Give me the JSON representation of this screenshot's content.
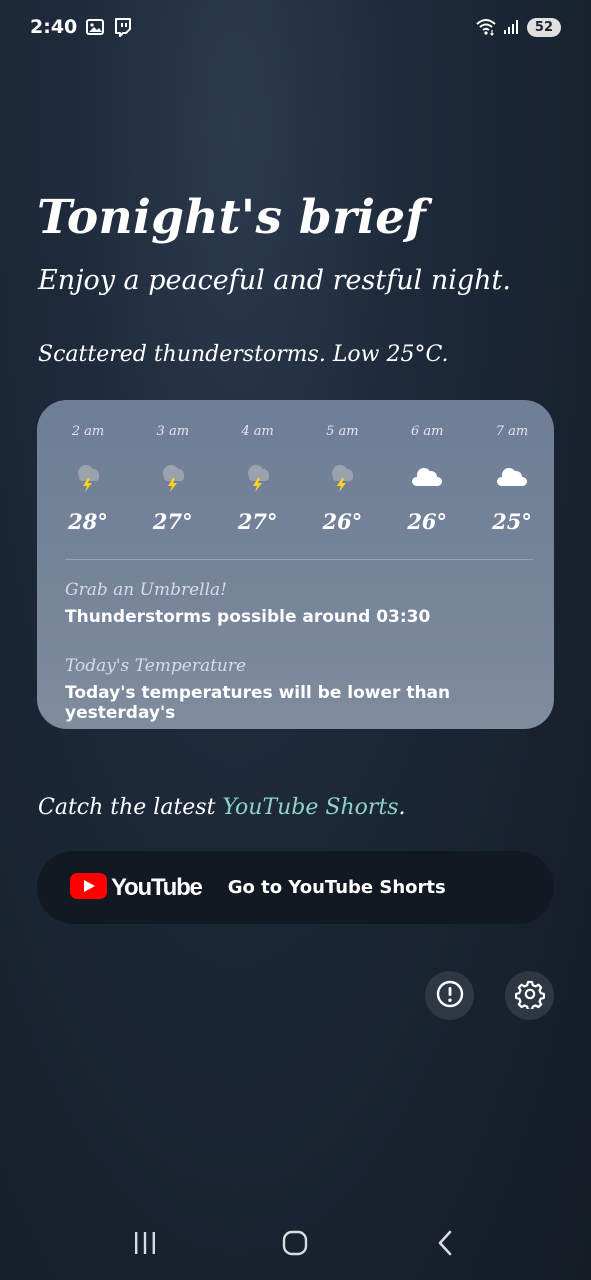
{
  "status_bar": {
    "time": "2:40",
    "notification_icons": [
      "image-icon",
      "twitch-icon"
    ],
    "system_icons": [
      "wifi-icon",
      "signal-icon"
    ],
    "battery": "52"
  },
  "brief": {
    "title": "Tonight's brief",
    "subtitle": "Enjoy a peaceful and restful night.",
    "summary": "Scattered thunderstorms. Low 25°C."
  },
  "forecast": {
    "hours": [
      {
        "time": "2 am",
        "icon": "thunderstorm-icon",
        "temp": "28°"
      },
      {
        "time": "3 am",
        "icon": "thunderstorm-icon",
        "temp": "27°"
      },
      {
        "time": "4 am",
        "icon": "thunderstorm-icon",
        "temp": "27°"
      },
      {
        "time": "5 am",
        "icon": "thunderstorm-icon",
        "temp": "26°"
      },
      {
        "time": "6 am",
        "icon": "cloud-icon",
        "temp": "26°"
      },
      {
        "time": "7 am",
        "icon": "cloud-icon",
        "temp": "25°"
      }
    ],
    "alerts": [
      {
        "heading": "Grab an Umbrella!",
        "body": "Thunderstorms possible around 03:30"
      },
      {
        "heading": "Today's Temperature",
        "body": "Today's temperatures will be lower than yesterday's"
      }
    ]
  },
  "youtube": {
    "caption_prefix": "Catch the latest ",
    "caption_link": "YouTube Shorts",
    "caption_suffix": ".",
    "logo_text": "YouTube",
    "button_label": "Go to YouTube Shorts"
  },
  "actions": {
    "info_icon": "info-icon",
    "settings_icon": "gear-icon"
  },
  "nav": {
    "icons": [
      "recents-icon",
      "home-icon",
      "back-icon"
    ]
  },
  "colors": {
    "background": "#1e2a3b",
    "card": "#76849a",
    "link": "#8fd3c8",
    "youtube_red": "#ff0000"
  }
}
